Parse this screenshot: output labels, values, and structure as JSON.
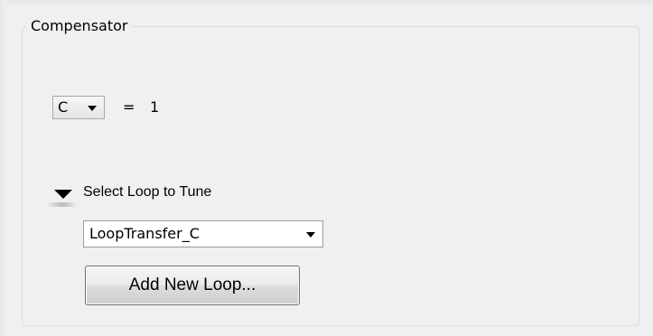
{
  "compensator": {
    "title": "Compensator",
    "selector": {
      "value": "C"
    },
    "equals": "=",
    "value": "1"
  },
  "loop": {
    "section_label": "Select Loop to Tune",
    "dropdown": {
      "selected": "LoopTransfer_C"
    },
    "add_button_label": "Add New Loop..."
  },
  "icons": {
    "selector_arrow": "chevron-down-icon",
    "expander": "expand-triangle-icon"
  },
  "colors": {
    "background": "#f0f0f0",
    "group_border": "#d5dfe5",
    "button_border": "#707070"
  }
}
